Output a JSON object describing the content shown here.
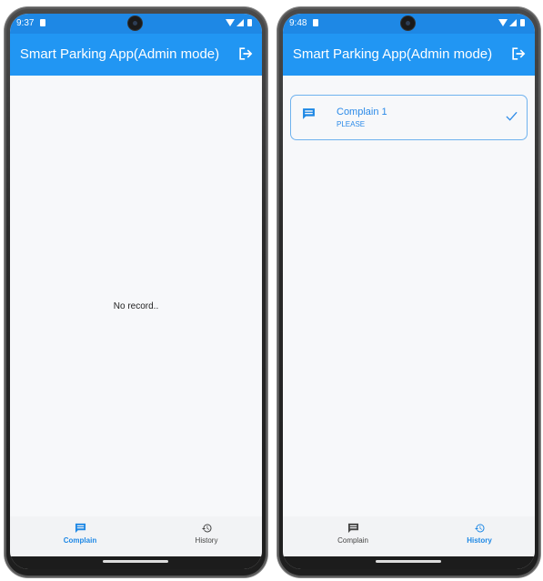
{
  "colors": {
    "primary": "#2196f3",
    "status_bar": "#1e88e5",
    "active_nav": "#1e88e5",
    "card_border": "#6fb2ee"
  },
  "screens": [
    {
      "status_time": "9:37",
      "app_title": "Smart Parking App(Admin mode)",
      "empty_message": "No record..",
      "nav": [
        {
          "label": "Complain",
          "icon": "message-icon",
          "active": true
        },
        {
          "label": "History",
          "icon": "history-icon",
          "active": false
        }
      ]
    },
    {
      "status_time": "9:48",
      "app_title": "Smart Parking App(Admin mode)",
      "complaints": [
        {
          "title": "Complain 1",
          "subtitle": "PLEASE",
          "icon": "message-icon",
          "status_icon": "check-icon"
        }
      ],
      "nav": [
        {
          "label": "Complain",
          "icon": "message-icon",
          "active": false
        },
        {
          "label": "History",
          "icon": "history-icon",
          "active": true
        }
      ]
    }
  ]
}
